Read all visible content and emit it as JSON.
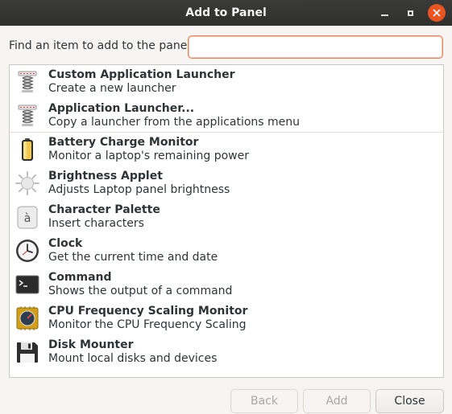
{
  "window": {
    "title": "Add to Panel",
    "accent_color": "#e95420"
  },
  "find": {
    "label": "Find an item to add to the panel:",
    "value": "",
    "placeholder": ""
  },
  "items": [
    {
      "name": "Custom Application Launcher",
      "description": "Create a new launcher",
      "icon": "launcher-spring-icon"
    },
    {
      "name": "Application Launcher...",
      "description": "Copy a launcher from the applications menu",
      "icon": "launcher-spring-icon"
    },
    {
      "name": "Battery Charge Monitor",
      "description": "Monitor a laptop's remaining power",
      "icon": "battery-icon"
    },
    {
      "name": "Brightness Applet",
      "description": "Adjusts Laptop panel brightness",
      "icon": "brightness-sun-icon"
    },
    {
      "name": "Character Palette",
      "description": "Insert characters",
      "icon": "character-palette-icon"
    },
    {
      "name": "Clock",
      "description": "Get the current time and date",
      "icon": "clock-icon"
    },
    {
      "name": "Command",
      "description": "Shows the output of a command",
      "icon": "terminal-icon"
    },
    {
      "name": "CPU Frequency Scaling Monitor",
      "description": "Monitor the CPU Frequency Scaling",
      "icon": "cpu-gauge-icon"
    },
    {
      "name": "Disk Mounter",
      "description": "Mount local disks and devices",
      "icon": "floppy-disk-icon"
    }
  ],
  "buttons": {
    "back": "Back",
    "add": "Add",
    "close": "Close"
  }
}
